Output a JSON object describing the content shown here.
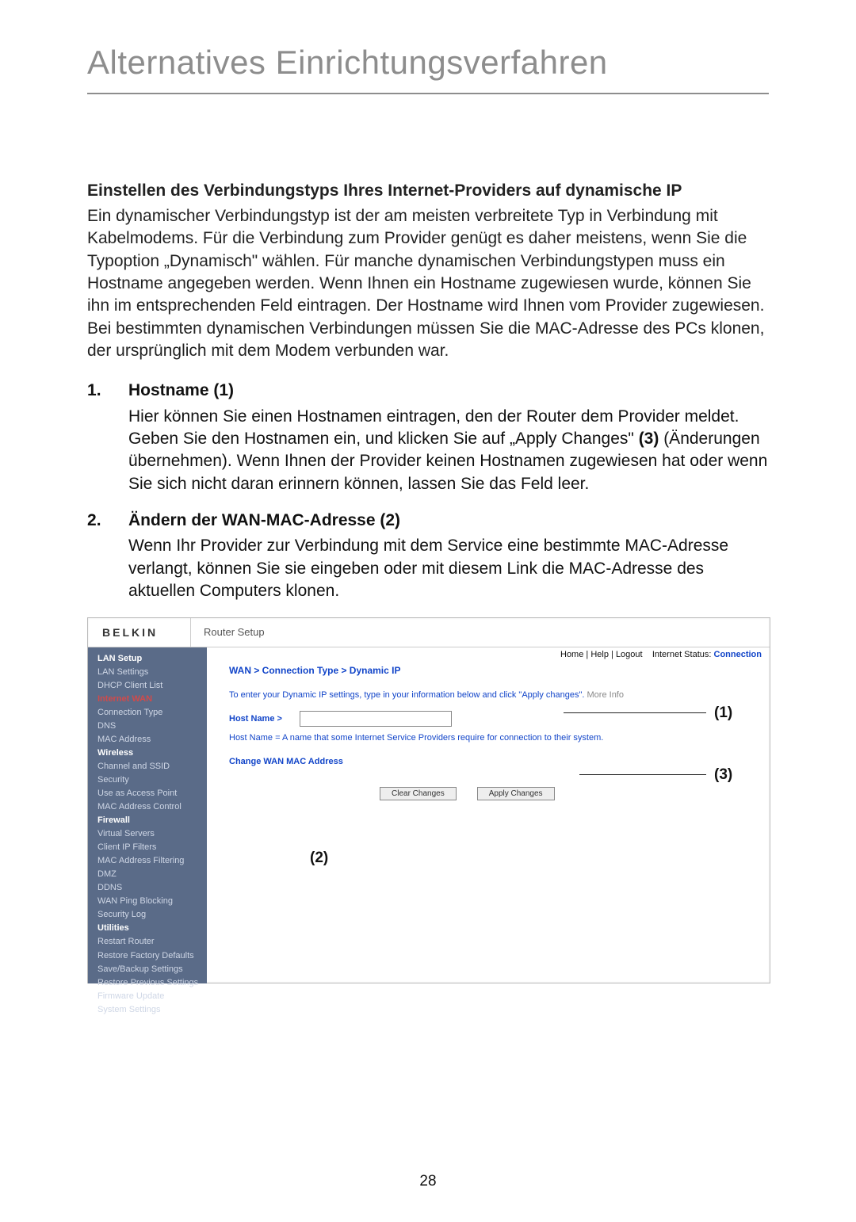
{
  "page_title": "Alternatives Einrichtungsverfahren",
  "section_heading": "Einstellen des Verbindungstyps Ihres Internet-Providers auf dynamische IP",
  "intro_paragraph": "Ein dynamischer Verbindungstyp ist der am meisten verbreitete Typ in Verbindung mit Kabelmodems. Für die Verbindung zum Provider genügt es daher meistens, wenn Sie die Typoption „Dynamisch\" wählen. Für manche dynamischen Verbindungstypen muss ein Hostname angegeben werden. Wenn Ihnen ein Hostname zugewiesen wurde, können Sie ihn im entsprechenden Feld eintragen. Der Hostname wird Ihnen vom Provider zugewiesen. Bei bestimmten dynamischen Verbindungen müssen Sie die MAC-Adresse des PCs klonen, der ursprünglich mit dem Modem verbunden war.",
  "list": [
    {
      "title": "Hostname (1)",
      "body_pre": "Hier können Sie einen Hostnamen eintragen, den der Router dem Provider meldet. Geben Sie den Hostnamen ein, und klicken Sie auf „Apply Changes\" ",
      "body_bold": "(3)",
      "body_post": " (Änderungen übernehmen). Wenn Ihnen der Provider keinen Hostnamen zugewiesen hat oder wenn Sie sich nicht daran erinnern können, lassen Sie das Feld leer."
    },
    {
      "title": "Ändern der WAN-MAC-Adresse (2)",
      "body_pre": "Wenn Ihr Provider zur Verbindung mit dem Service eine bestimmte MAC-Adresse verlangt, können Sie sie eingeben oder mit diesem Link die MAC-Adresse des aktuellen Computers klonen.",
      "body_bold": "",
      "body_post": ""
    }
  ],
  "shot": {
    "logo": "BELKIN",
    "header": "Router Setup",
    "top_links": {
      "home": "Home",
      "help": "Help",
      "logout": "Logout",
      "status_label": "Internet Status:",
      "status_value": "Connection"
    },
    "sidebar": {
      "groups": [
        {
          "hdr": "LAN Setup",
          "items": [
            "LAN Settings",
            "DHCP Client List"
          ]
        },
        {
          "hdr_red": "Internet WAN",
          "items": [
            "Connection Type",
            "DNS",
            "MAC Address"
          ]
        },
        {
          "hdr": "Wireless",
          "items": [
            "Channel and SSID",
            "Security",
            "Use as Access Point",
            "MAC Address Control"
          ]
        },
        {
          "hdr": "Firewall",
          "items": [
            "Virtual Servers",
            "Client IP Filters",
            "MAC Address Filtering",
            "DMZ",
            "DDNS",
            "WAN Ping Blocking",
            "Security Log"
          ]
        },
        {
          "hdr": "Utilities",
          "items": [
            "Restart Router",
            "Restore Factory Defaults",
            "Save/Backup Settings",
            "Restore Previous Settings",
            "Firmware Update",
            "System Settings"
          ]
        }
      ]
    },
    "breadcrumb": "WAN > Connection Type > Dynamic IP",
    "instruction": "To enter your Dynamic IP settings, type in your information below and click \"Apply changes\".",
    "more_info": "More Info",
    "host_label": "Host Name >",
    "host_note": "Host Name = A name that some Internet Service Providers require for connection to their system.",
    "change_mac_link": "Change WAN MAC Address",
    "btn_clear": "Clear Changes",
    "btn_apply": "Apply Changes",
    "callouts": {
      "c1": "(1)",
      "c2": "(2)",
      "c3": "(3)"
    }
  },
  "page_number": "28"
}
